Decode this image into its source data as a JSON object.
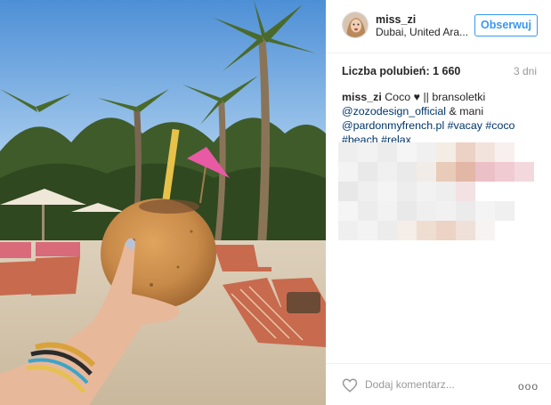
{
  "post": {
    "username": "miss_zi",
    "location": "Dubai, United Ara...",
    "follow_label": "Obserwuj",
    "likes_label": "Liczba polubień:",
    "likes_count": "1 660",
    "time_ago": "3 dni",
    "caption": {
      "user": "miss_zi",
      "text1": "Coco",
      "heart": "♥",
      "text2": "|| bransoletki",
      "mention1": "@zozodesign_official",
      "text3": "& mani",
      "mention2": "@pardonmyfrench.pl",
      "tags": [
        "#vacay",
        "#coco",
        "#beach",
        "#relax"
      ]
    },
    "comment_placeholder": "Dodaj komentarz...",
    "more_label": "ooo"
  },
  "icons": {
    "heart": "heart-icon",
    "more": "more-options-icon"
  },
  "colors": {
    "accent": "#3897f0",
    "link": "#003569",
    "muted": "#999999"
  }
}
